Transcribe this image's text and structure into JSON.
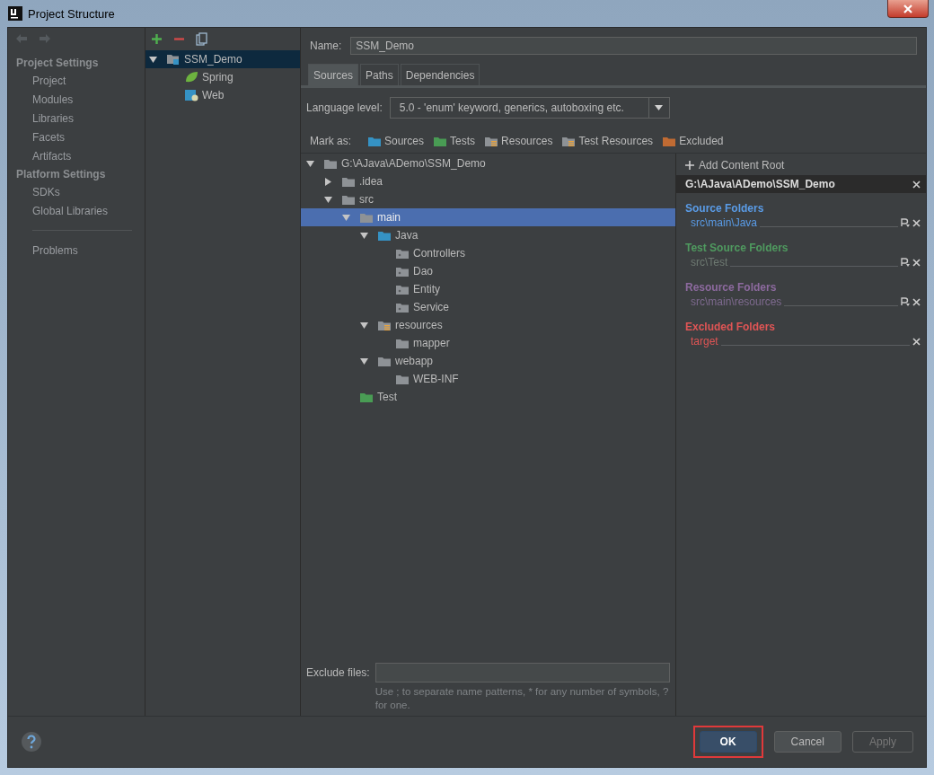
{
  "window": {
    "title": "Project Structure"
  },
  "sidebar": {
    "groups": [
      {
        "heading": "Project Settings",
        "items": [
          {
            "label": "Project",
            "selected": false
          },
          {
            "label": "Modules",
            "selected": false
          },
          {
            "label": "Libraries",
            "selected": false
          },
          {
            "label": "Facets",
            "selected": false
          },
          {
            "label": "Artifacts",
            "selected": false
          }
        ]
      },
      {
        "heading": "Platform Settings",
        "items": [
          {
            "label": "SDKs",
            "selected": false
          },
          {
            "label": "Global Libraries",
            "selected": false
          }
        ]
      },
      {
        "items": [
          {
            "label": "Problems",
            "selected": false
          }
        ]
      }
    ]
  },
  "modules": {
    "tree": [
      {
        "label": "SSM_Demo",
        "kind": "module",
        "selected": true,
        "expanded": true,
        "children": [
          {
            "label": "Spring",
            "kind": "spring",
            "selected": false
          },
          {
            "label": "Web",
            "kind": "web",
            "selected": false
          }
        ]
      }
    ]
  },
  "name_field": {
    "label": "Name:",
    "value": "SSM_Demo"
  },
  "tabs": [
    {
      "label": "Sources",
      "selected": true
    },
    {
      "label": "Paths",
      "selected": false
    },
    {
      "label": "Dependencies",
      "selected": false
    }
  ],
  "language_level": {
    "label": "Language level:",
    "value": "5.0 - 'enum' keyword, generics, autoboxing etc."
  },
  "mark_as": {
    "label": "Mark as:",
    "options": [
      {
        "label": "Sources",
        "kind": "source"
      },
      {
        "label": "Tests",
        "kind": "test"
      },
      {
        "label": "Resources",
        "kind": "resource"
      },
      {
        "label": "Test Resources",
        "kind": "test_resource"
      },
      {
        "label": "Excluded",
        "kind": "excluded"
      }
    ]
  },
  "file_tree": [
    {
      "label": "G:\\AJava\\ADemo\\SSM_Demo",
      "kind": "folder",
      "expanded": true,
      "selected": false,
      "children": [
        {
          "label": ".idea",
          "kind": "folder",
          "expanded": false,
          "selected": false
        },
        {
          "label": "src",
          "kind": "folder",
          "expanded": true,
          "selected": false,
          "children": [
            {
              "label": "main",
              "kind": "folder",
              "expanded": true,
              "selected": true,
              "children": [
                {
                  "label": "Java",
                  "kind": "source",
                  "expanded": true,
                  "selected": false,
                  "children": [
                    {
                      "label": "Controllers",
                      "kind": "package",
                      "selected": false
                    },
                    {
                      "label": "Dao",
                      "kind": "package",
                      "selected": false
                    },
                    {
                      "label": "Entity",
                      "kind": "package",
                      "selected": false
                    },
                    {
                      "label": "Service",
                      "kind": "package",
                      "selected": false
                    }
                  ]
                },
                {
                  "label": "resources",
                  "kind": "resource",
                  "expanded": true,
                  "selected": false,
                  "children": [
                    {
                      "label": "mapper",
                      "kind": "folder",
                      "selected": false
                    }
                  ]
                },
                {
                  "label": "webapp",
                  "kind": "folder",
                  "expanded": true,
                  "selected": false,
                  "children": [
                    {
                      "label": "WEB-INF",
                      "kind": "folder",
                      "selected": false
                    }
                  ]
                }
              ]
            },
            {
              "label": "Test",
              "kind": "test",
              "selected": false
            }
          ]
        }
      ]
    }
  ],
  "exclude_files": {
    "label": "Exclude files:",
    "hint": "Use ; to separate name patterns, * for any number of symbols, ? for one."
  },
  "content_root": {
    "add_label": "Add Content Root",
    "path": "G:\\AJava\\ADemo\\SSM_Demo",
    "groups": [
      {
        "title": "Source Folders",
        "kind": "source",
        "folders": [
          "src\\main\\Java"
        ]
      },
      {
        "title": "Test Source Folders",
        "kind": "test",
        "folders": [
          "src\\Test"
        ]
      },
      {
        "title": "Resource Folders",
        "kind": "resource",
        "folders": [
          "src\\main\\resources"
        ]
      },
      {
        "title": "Excluded Folders",
        "kind": "excluded",
        "folders": [
          "target"
        ]
      }
    ]
  },
  "buttons": [
    {
      "label": "OK",
      "kind": "default",
      "disabled": false,
      "highlighted": true
    },
    {
      "label": "Cancel",
      "kind": "normal",
      "disabled": false,
      "highlighted": false
    },
    {
      "label": "Apply",
      "kind": "normal",
      "disabled": true,
      "highlighted": false
    }
  ]
}
